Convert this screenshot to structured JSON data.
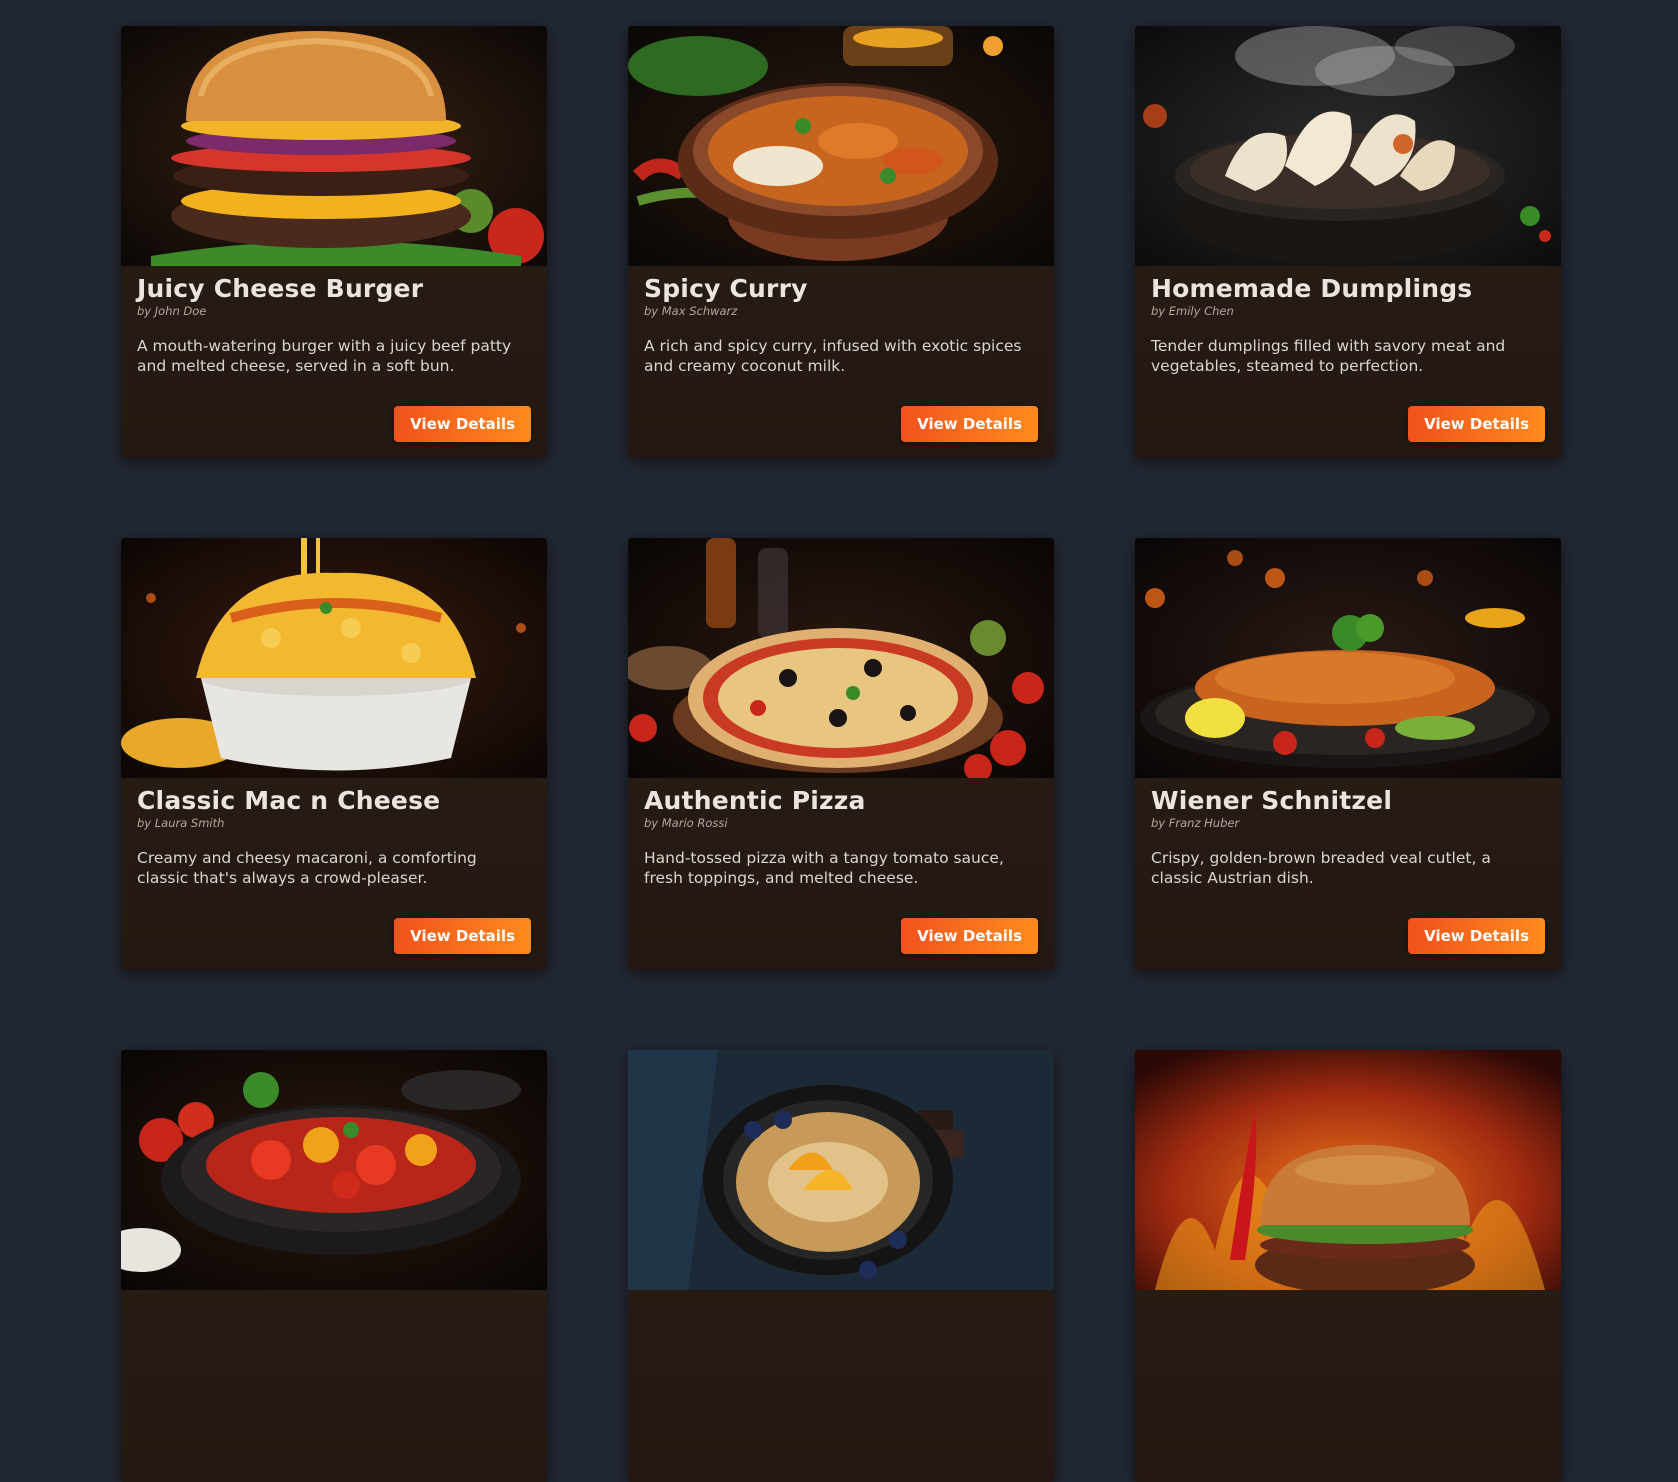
{
  "recipes": [
    {
      "title": "Juicy Cheese Burger",
      "author": "by John Doe",
      "description": "A mouth-watering burger with a juicy beef patty and melted cheese, served in a soft bun.",
      "button": "View Details",
      "image": "burger"
    },
    {
      "title": "Spicy Curry",
      "author": "by Max Schwarz",
      "description": "A rich and spicy curry, infused with exotic spices and creamy coconut milk.",
      "button": "View Details",
      "image": "curry"
    },
    {
      "title": "Homemade Dumplings",
      "author": "by Emily Chen",
      "description": "Tender dumplings filled with savory meat and vegetables, steamed to perfection.",
      "button": "View Details",
      "image": "dumplings"
    },
    {
      "title": "Classic Mac n Cheese",
      "author": "by Laura Smith",
      "description": "Creamy and cheesy macaroni, a comforting classic that's always a crowd-pleaser.",
      "button": "View Details",
      "image": "mac-and-cheese"
    },
    {
      "title": "Authentic Pizza",
      "author": "by Mario Rossi",
      "description": "Hand-tossed pizza with a tangy tomato sauce, fresh toppings, and melted cheese.",
      "button": "View Details",
      "image": "pizza"
    },
    {
      "title": "Wiener Schnitzel",
      "author": "by Franz Huber",
      "description": "Crispy, golden-brown breaded veal cutlet, a classic Austrian dish.",
      "button": "View Details",
      "image": "schnitzel"
    },
    {
      "title": "",
      "author": "",
      "description": "",
      "button": "",
      "image": "tomato-salad"
    },
    {
      "title": "",
      "author": "",
      "description": "",
      "button": "",
      "image": "pancake"
    },
    {
      "title": "",
      "author": "",
      "description": "",
      "button": "",
      "image": "flaming-burger"
    }
  ],
  "colors": {
    "page_background": "#222833",
    "card_background": "#2a1f17",
    "button_gradient_start": "#f0521c",
    "button_gradient_end": "#ff8b1e"
  }
}
